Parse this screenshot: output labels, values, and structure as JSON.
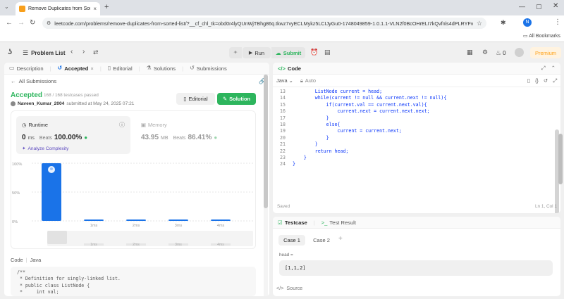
{
  "browser": {
    "tab_title": "Remove Duplicates from Sorted",
    "new_tab_symbol": "+",
    "url": "leetcode.com/problems/remove-duplicates-from-sorted-list/?__cf_chl_tk=obd0r4lyQUnWjTBhg86q.tkwz7vyECLMykz5LCIJyGu0-1748049859-1.0.1.1-VLN2f0BcOHrELI7kQvfnls4dPLRYFvn56eljdByP...",
    "profile_initial": "N",
    "bookmarks_label": "All Bookmarks"
  },
  "nav": {
    "problem_list": "Problem List",
    "run": "Run",
    "submit": "Submit",
    "premium": "Premium",
    "fire_count": "0"
  },
  "left": {
    "tabs": [
      "Description",
      "Accepted",
      "Editorial",
      "Solutions",
      "Submissions"
    ],
    "tab_close": "×",
    "all_submissions": "All Submissions",
    "status": "Accepted",
    "testcases": "168 / 168 testcases passed",
    "author": "Naveen_Kumar_2004",
    "submitted_at": "submitted at May 24, 2025 07:21",
    "editorial_btn": "Editorial",
    "solution_btn": "Solution",
    "runtime": {
      "label": "Runtime",
      "value": "0",
      "unit": "ms",
      "beats_label": "Beats",
      "beats": "100.00%"
    },
    "memory": {
      "label": "Memory",
      "value": "43.95",
      "unit": "MB",
      "beats_label": "Beats",
      "beats": "86.41%"
    },
    "analyze": "Analyze Complexity",
    "code_label": "Code",
    "code_lang": "Java",
    "code_preview": [
      "/**",
      " * Definition for singly-linked list.",
      " * public class ListNode {",
      " *     int val;"
    ]
  },
  "chart_data": {
    "type": "bar",
    "categories": [
      "0ms",
      "1ms",
      "2ms",
      "3ms",
      "4ms"
    ],
    "values": [
      100,
      1,
      1,
      1,
      1
    ],
    "y_ticks": [
      "100%",
      "50%",
      "0%"
    ],
    "ylim": [
      0,
      100
    ],
    "highlight_color": "#1a73e8",
    "bar_color": "#1a73e8",
    "mini_labels": [
      "1ms",
      "2ms",
      "3ms",
      "4ms"
    ]
  },
  "code": {
    "title": "Code",
    "lang": "Java",
    "mode": "Auto",
    "saved": "Saved",
    "cursor": "Ln 1, Col 1",
    "lines": [
      {
        "n": "13",
        "text": "        ListNode current = head;"
      },
      {
        "n": "14",
        "text": "        while(current != null && current.next != null){"
      },
      {
        "n": "15",
        "text": "            if(current.val == current.next.val){"
      },
      {
        "n": "16",
        "text": "                current.next = current.next.next;"
      },
      {
        "n": "17",
        "text": "            }"
      },
      {
        "n": "18",
        "text": "            else{"
      },
      {
        "n": "19",
        "text": "                current = current.next;"
      },
      {
        "n": "20",
        "text": "            }"
      },
      {
        "n": "21",
        "text": "        }"
      },
      {
        "n": "22",
        "text": "        return head;"
      },
      {
        "n": "23",
        "text": "    }"
      },
      {
        "n": "24",
        "text": "}"
      }
    ]
  },
  "testcase": {
    "tab": "Testcase",
    "result_tab": "Test Result",
    "cases": [
      "Case 1",
      "Case 2"
    ],
    "add": "+",
    "param": "head =",
    "value": "[1,1,2]",
    "source": "Source"
  }
}
